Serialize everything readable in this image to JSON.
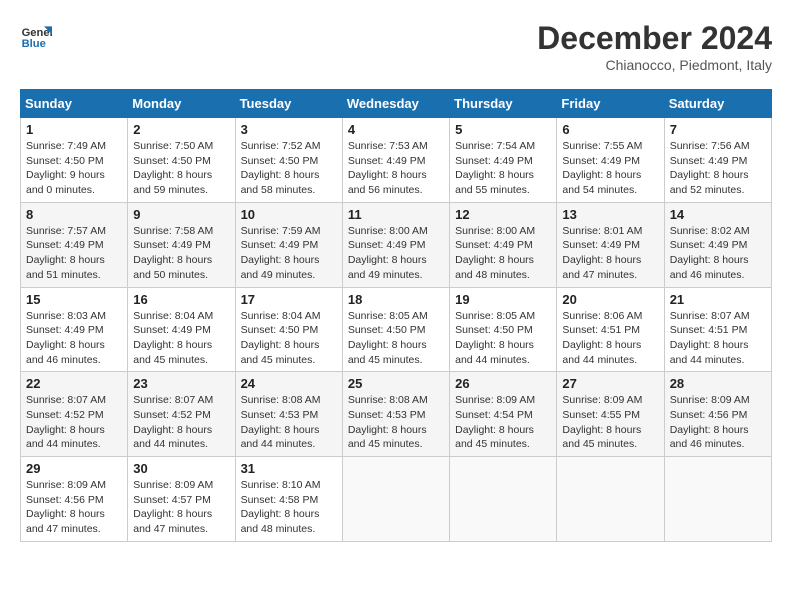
{
  "header": {
    "logo_line1": "General",
    "logo_line2": "Blue",
    "month": "December 2024",
    "location": "Chianocco, Piedmont, Italy"
  },
  "weekdays": [
    "Sunday",
    "Monday",
    "Tuesday",
    "Wednesday",
    "Thursday",
    "Friday",
    "Saturday"
  ],
  "weeks": [
    [
      {
        "day": "1",
        "info": "Sunrise: 7:49 AM\nSunset: 4:50 PM\nDaylight: 9 hours\nand 0 minutes."
      },
      {
        "day": "2",
        "info": "Sunrise: 7:50 AM\nSunset: 4:50 PM\nDaylight: 8 hours\nand 59 minutes."
      },
      {
        "day": "3",
        "info": "Sunrise: 7:52 AM\nSunset: 4:50 PM\nDaylight: 8 hours\nand 58 minutes."
      },
      {
        "day": "4",
        "info": "Sunrise: 7:53 AM\nSunset: 4:49 PM\nDaylight: 8 hours\nand 56 minutes."
      },
      {
        "day": "5",
        "info": "Sunrise: 7:54 AM\nSunset: 4:49 PM\nDaylight: 8 hours\nand 55 minutes."
      },
      {
        "day": "6",
        "info": "Sunrise: 7:55 AM\nSunset: 4:49 PM\nDaylight: 8 hours\nand 54 minutes."
      },
      {
        "day": "7",
        "info": "Sunrise: 7:56 AM\nSunset: 4:49 PM\nDaylight: 8 hours\nand 52 minutes."
      }
    ],
    [
      {
        "day": "8",
        "info": "Sunrise: 7:57 AM\nSunset: 4:49 PM\nDaylight: 8 hours\nand 51 minutes."
      },
      {
        "day": "9",
        "info": "Sunrise: 7:58 AM\nSunset: 4:49 PM\nDaylight: 8 hours\nand 50 minutes."
      },
      {
        "day": "10",
        "info": "Sunrise: 7:59 AM\nSunset: 4:49 PM\nDaylight: 8 hours\nand 49 minutes."
      },
      {
        "day": "11",
        "info": "Sunrise: 8:00 AM\nSunset: 4:49 PM\nDaylight: 8 hours\nand 49 minutes."
      },
      {
        "day": "12",
        "info": "Sunrise: 8:00 AM\nSunset: 4:49 PM\nDaylight: 8 hours\nand 48 minutes."
      },
      {
        "day": "13",
        "info": "Sunrise: 8:01 AM\nSunset: 4:49 PM\nDaylight: 8 hours\nand 47 minutes."
      },
      {
        "day": "14",
        "info": "Sunrise: 8:02 AM\nSunset: 4:49 PM\nDaylight: 8 hours\nand 46 minutes."
      }
    ],
    [
      {
        "day": "15",
        "info": "Sunrise: 8:03 AM\nSunset: 4:49 PM\nDaylight: 8 hours\nand 46 minutes."
      },
      {
        "day": "16",
        "info": "Sunrise: 8:04 AM\nSunset: 4:49 PM\nDaylight: 8 hours\nand 45 minutes."
      },
      {
        "day": "17",
        "info": "Sunrise: 8:04 AM\nSunset: 4:50 PM\nDaylight: 8 hours\nand 45 minutes."
      },
      {
        "day": "18",
        "info": "Sunrise: 8:05 AM\nSunset: 4:50 PM\nDaylight: 8 hours\nand 45 minutes."
      },
      {
        "day": "19",
        "info": "Sunrise: 8:05 AM\nSunset: 4:50 PM\nDaylight: 8 hours\nand 44 minutes."
      },
      {
        "day": "20",
        "info": "Sunrise: 8:06 AM\nSunset: 4:51 PM\nDaylight: 8 hours\nand 44 minutes."
      },
      {
        "day": "21",
        "info": "Sunrise: 8:07 AM\nSunset: 4:51 PM\nDaylight: 8 hours\nand 44 minutes."
      }
    ],
    [
      {
        "day": "22",
        "info": "Sunrise: 8:07 AM\nSunset: 4:52 PM\nDaylight: 8 hours\nand 44 minutes."
      },
      {
        "day": "23",
        "info": "Sunrise: 8:07 AM\nSunset: 4:52 PM\nDaylight: 8 hours\nand 44 minutes."
      },
      {
        "day": "24",
        "info": "Sunrise: 8:08 AM\nSunset: 4:53 PM\nDaylight: 8 hours\nand 44 minutes."
      },
      {
        "day": "25",
        "info": "Sunrise: 8:08 AM\nSunset: 4:53 PM\nDaylight: 8 hours\nand 45 minutes."
      },
      {
        "day": "26",
        "info": "Sunrise: 8:09 AM\nSunset: 4:54 PM\nDaylight: 8 hours\nand 45 minutes."
      },
      {
        "day": "27",
        "info": "Sunrise: 8:09 AM\nSunset: 4:55 PM\nDaylight: 8 hours\nand 45 minutes."
      },
      {
        "day": "28",
        "info": "Sunrise: 8:09 AM\nSunset: 4:56 PM\nDaylight: 8 hours\nand 46 minutes."
      }
    ],
    [
      {
        "day": "29",
        "info": "Sunrise: 8:09 AM\nSunset: 4:56 PM\nDaylight: 8 hours\nand 47 minutes."
      },
      {
        "day": "30",
        "info": "Sunrise: 8:09 AM\nSunset: 4:57 PM\nDaylight: 8 hours\nand 47 minutes."
      },
      {
        "day": "31",
        "info": "Sunrise: 8:10 AM\nSunset: 4:58 PM\nDaylight: 8 hours\nand 48 minutes."
      },
      null,
      null,
      null,
      null
    ]
  ]
}
